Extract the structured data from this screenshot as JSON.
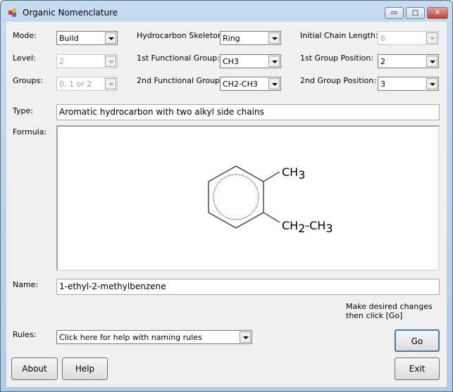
{
  "window": {
    "title": "Organic Nomenclature",
    "minimize": "▭",
    "maximize": "□",
    "close": "✕"
  },
  "labels": {
    "mode": "Mode:",
    "level": "Level:",
    "groups": "Groups:",
    "skeleton": "Hydrocarbon Skeleton:",
    "fg1": "1st Functional Group:",
    "fg2": "2nd Functional Group:",
    "chain": "Initial Chain Length:",
    "pos1": "1st Group Position:",
    "pos2": "2nd Group Position:",
    "type": "Type:",
    "formula": "Formula:",
    "name": "Name:",
    "rules": "Rules:"
  },
  "values": {
    "mode": "Build",
    "level": "2",
    "groups": "0, 1 or 2",
    "skeleton": "Ring",
    "fg1": "CH3",
    "fg2": "CH2-CH3",
    "chain": "6",
    "pos1": "2",
    "pos2": "3",
    "rules": "Click here for help with naming rules"
  },
  "type": "Aromatic hydrocarbon with two alkyl side chains",
  "formula": {
    "sub1": "CH",
    "sub1_n": "3",
    "sub2a": "CH",
    "sub2a_n": "2",
    "sub2b": "-CH",
    "sub2b_n": "3"
  },
  "name": "1-ethyl-2-methylbenzene",
  "hint": {
    "line1": "Make desired changes",
    "line2": "then click [Go]"
  },
  "buttons": {
    "go": "Go",
    "about": "About",
    "help": "Help",
    "exit": "Exit"
  }
}
